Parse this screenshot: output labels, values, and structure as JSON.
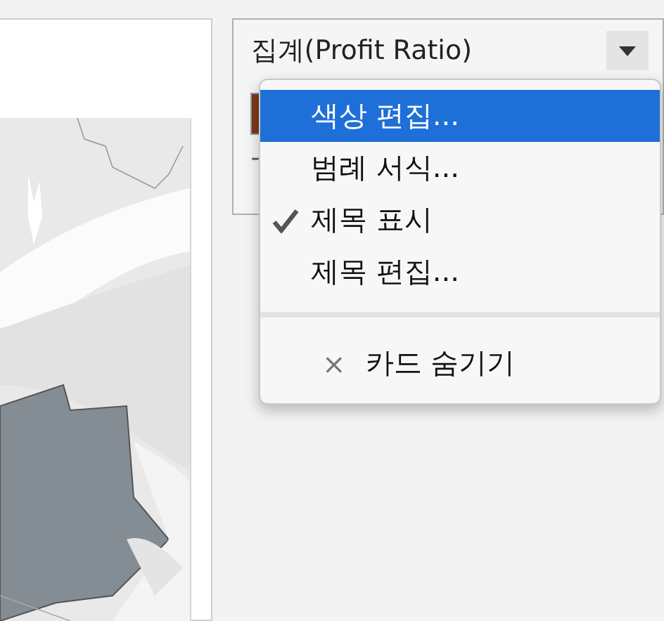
{
  "legend": {
    "title": "집계(Profit Ratio)",
    "min_label": "-"
  },
  "menu": {
    "items": [
      {
        "kind": "item",
        "label": "색상 편집...",
        "selected": true,
        "checked": false
      },
      {
        "kind": "item",
        "label": "범례 서식...",
        "selected": false,
        "checked": false
      },
      {
        "kind": "item",
        "label": "제목 표시",
        "selected": false,
        "checked": true
      },
      {
        "kind": "item",
        "label": "제목 편집...",
        "selected": false,
        "checked": false
      },
      {
        "kind": "separator"
      },
      {
        "kind": "action",
        "icon": "×",
        "label": "카드 숨기기",
        "selected": false
      }
    ]
  }
}
